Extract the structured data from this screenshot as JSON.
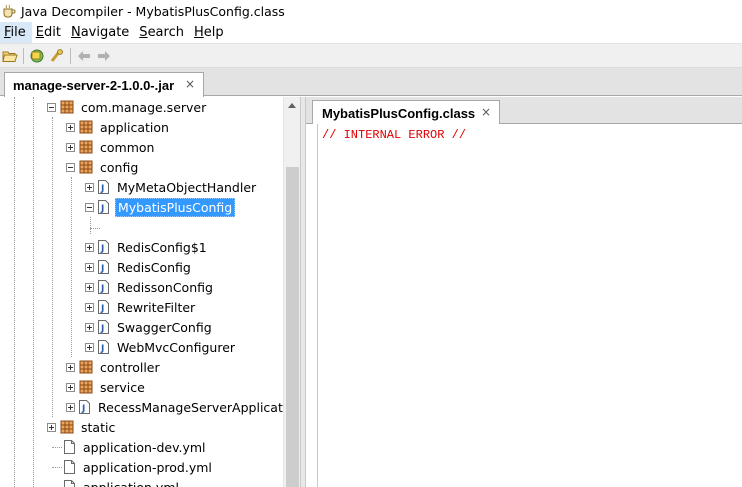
{
  "window": {
    "title": "Java Decompiler - MybatisPlusConfig.class"
  },
  "menu": [
    {
      "label": "File",
      "underline": "F",
      "rest": "ile",
      "active": true
    },
    {
      "label": "Edit",
      "underline": "E",
      "rest": "dit",
      "active": false
    },
    {
      "label": "Navigate",
      "underline": "N",
      "rest": "avigate",
      "active": false
    },
    {
      "label": "Search",
      "underline": "S",
      "rest": "earch",
      "active": false
    },
    {
      "label": "Help",
      "underline": "H",
      "rest": "elp",
      "active": false
    }
  ],
  "toolbar": {
    "buttons": [
      {
        "name": "open-file-icon"
      },
      {
        "name": "open-type-icon"
      },
      {
        "name": "search-icon"
      },
      {
        "name": "back-arrow-icon"
      },
      {
        "name": "forward-arrow-icon"
      }
    ]
  },
  "jar_tab": {
    "label": "manage-server-2-1.0.0-.jar",
    "close": "×"
  },
  "tree": {
    "items": [
      {
        "label": "com.manage.server",
        "type": "package",
        "expander": "minus"
      },
      {
        "label": "application",
        "type": "package",
        "expander": "plus"
      },
      {
        "label": "common",
        "type": "package",
        "expander": "plus"
      },
      {
        "label": "config",
        "type": "package",
        "expander": "minus"
      },
      {
        "label": "MyMetaObjectHandler",
        "type": "class",
        "expander": "plus"
      },
      {
        "label": "MybatisPlusConfig",
        "type": "class",
        "expander": "minus",
        "selected": true
      },
      {
        "label": "RedisConfig$1",
        "type": "class",
        "expander": "plus"
      },
      {
        "label": "RedisConfig",
        "type": "class",
        "expander": "plus"
      },
      {
        "label": "RedissonConfig",
        "type": "class",
        "expander": "plus"
      },
      {
        "label": "RewriteFilter",
        "type": "class",
        "expander": "plus"
      },
      {
        "label": "SwaggerConfig",
        "type": "class",
        "expander": "plus"
      },
      {
        "label": "WebMvcConfigurer",
        "type": "class",
        "expander": "plus"
      },
      {
        "label": "controller",
        "type": "package",
        "expander": "plus"
      },
      {
        "label": "service",
        "type": "package",
        "expander": "plus"
      },
      {
        "label": "RecessManageServerApplicatic",
        "type": "class",
        "expander": "plus"
      },
      {
        "label": "static",
        "type": "package",
        "expander": "plus"
      },
      {
        "label": "application-dev.yml",
        "type": "file"
      },
      {
        "label": "application-prod.yml",
        "type": "file"
      },
      {
        "label": "application.yml",
        "type": "file"
      }
    ]
  },
  "editor_tab": {
    "label": "MybatisPlusConfig.class",
    "close": "×"
  },
  "editor": {
    "code": "// INTERNAL ERROR //"
  },
  "colors": {
    "selection": "#3399ff",
    "error_text": "#e00000",
    "package_icon": "#c86a1e"
  }
}
